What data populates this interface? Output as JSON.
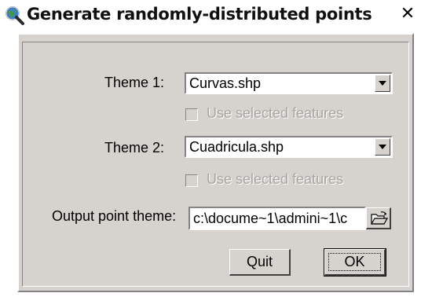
{
  "window": {
    "title": "Generate randomly-distributed points",
    "icon": "globe-magnifier-icon",
    "close_glyph": "✕"
  },
  "form": {
    "theme1": {
      "label": "Theme 1:",
      "value": "Curvas.shp",
      "use_selected_label": "Use selected  features",
      "use_selected_checked": false,
      "use_selected_enabled": false
    },
    "theme2": {
      "label": "Theme 2:",
      "value": "Cuadricula.shp",
      "use_selected_label": "Use selected  features",
      "use_selected_checked": false,
      "use_selected_enabled": false
    },
    "output": {
      "label": "Output point theme:",
      "value": "c:\\docume~1\\admini~1\\c",
      "browse_icon": "open-folder-icon"
    }
  },
  "buttons": {
    "quit_label": "Quit",
    "ok_label": "OK"
  },
  "colors": {
    "dialog_face": "#d6d3ce",
    "shadow": "#848284",
    "disabled_text": "#a8a6a2"
  }
}
